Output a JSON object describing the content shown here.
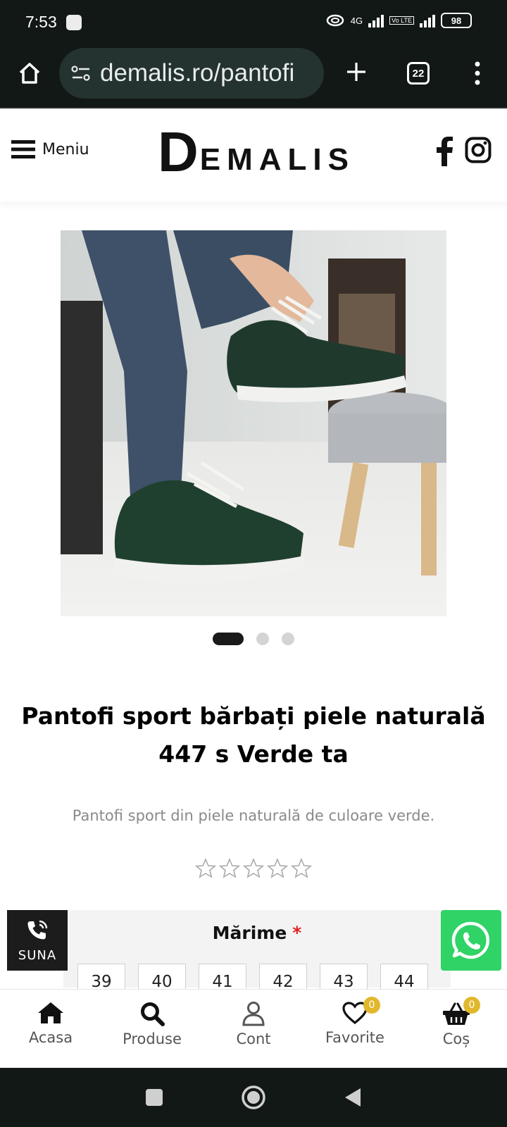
{
  "status_bar": {
    "time": "7:53",
    "network": "4G",
    "volte": "Vo LTE",
    "battery": "98"
  },
  "browser": {
    "url": "demalis.ro/pantofi",
    "tab_count": "22"
  },
  "header": {
    "menu_label": "Meniu",
    "logo_initial": "D",
    "logo_rest": "EMALIS"
  },
  "gallery": {
    "image_count": 3,
    "active_index": 0
  },
  "product": {
    "title": "Pantofi sport bărbați piele naturală 447 s Verde ta",
    "description": "Pantofi sport din piele naturală de culoare verde.",
    "rating": 0,
    "rating_max": 5,
    "size_label": "Mărime",
    "required_mark": "*",
    "sizes": [
      "39",
      "40",
      "41",
      "42",
      "43",
      "44"
    ]
  },
  "call_button": {
    "label": "SUNA"
  },
  "bottom_nav": {
    "items": [
      {
        "label": "Acasa"
      },
      {
        "label": "Produse"
      },
      {
        "label": "Cont"
      },
      {
        "label": "Favorite",
        "badge": "0"
      },
      {
        "label": "Coș",
        "badge": "0"
      }
    ]
  },
  "colors": {
    "dark": "#111816",
    "whatsapp": "#2fd366",
    "badge": "#e1b82c",
    "required": "#e02020"
  }
}
